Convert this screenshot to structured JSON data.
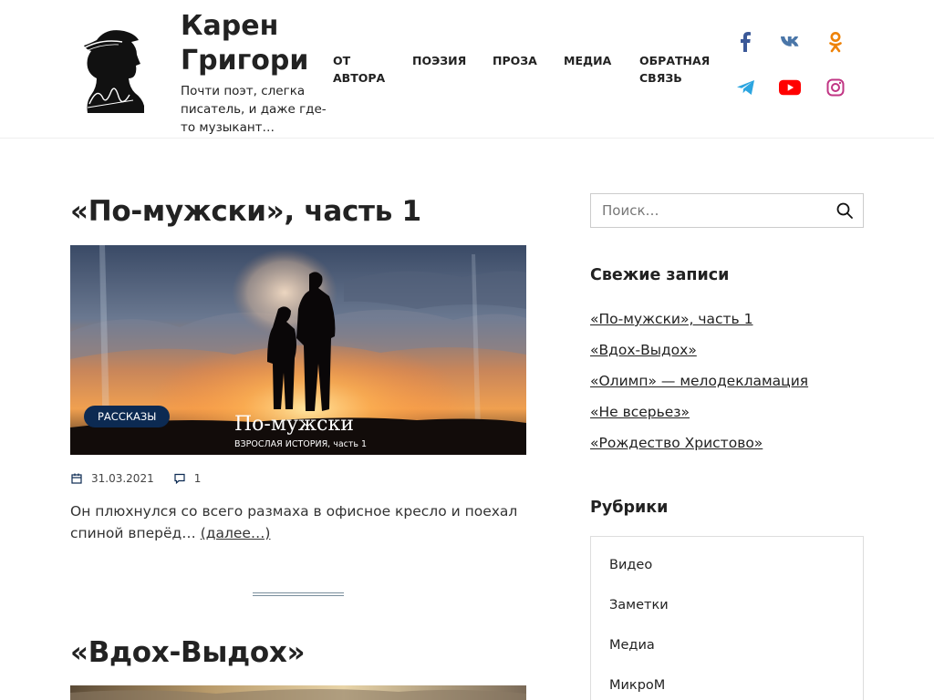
{
  "header": {
    "site_title": "Карен Григори",
    "site_description": "Почти поэт, слегка писатель, и даже где-то музыкант…",
    "logo_icon": "silhouette-portrait-logo"
  },
  "nav": {
    "items": [
      {
        "label": "ОТ АВТОРА"
      },
      {
        "label": "ПОЭЗИЯ"
      },
      {
        "label": "ПРОЗА"
      },
      {
        "label": "МЕДИА"
      },
      {
        "label": "ОБРАТНАЯ СВЯЗЬ"
      }
    ]
  },
  "social": {
    "colors": {
      "facebook": "#3b5998",
      "vk": "#4a76a8",
      "odnoklassniki": "#ee8208",
      "telegram": "#2ca5e0",
      "youtube": "#ff0000",
      "instagram": "#c13584"
    }
  },
  "posts": [
    {
      "title": "«По-мужски», часть 1",
      "category": "РАССКАЗЫ",
      "image_caption": "По-мужски",
      "image_subcaption": "ВЗРОСЛАЯ ИСТОРИЯ, часть 1",
      "date": "31.03.2021",
      "comments": "1",
      "excerpt": "Он плюхнулся со всего размаха в офисное кресло и поехал спиной вперёд…",
      "more_label": "(далее…)"
    },
    {
      "title": "«Вдох-Выдох»"
    }
  ],
  "sidebar": {
    "search_placeholder": "Поиск…",
    "recent_title": "Свежие записи",
    "recent_posts": [
      "«По-мужски», часть 1",
      "«Вдох-Выдох»",
      "«Олимп» — мелодекламация",
      "«Не всерьез»",
      "«Рождество Христово»"
    ],
    "categories_title": "Рубрики",
    "categories": [
      "Видео",
      "Заметки",
      "Медиа",
      "МикроМ"
    ]
  },
  "colors": {
    "badge_bg": "#0c2a52",
    "text": "#222222",
    "separator": "#7a8e9c"
  }
}
